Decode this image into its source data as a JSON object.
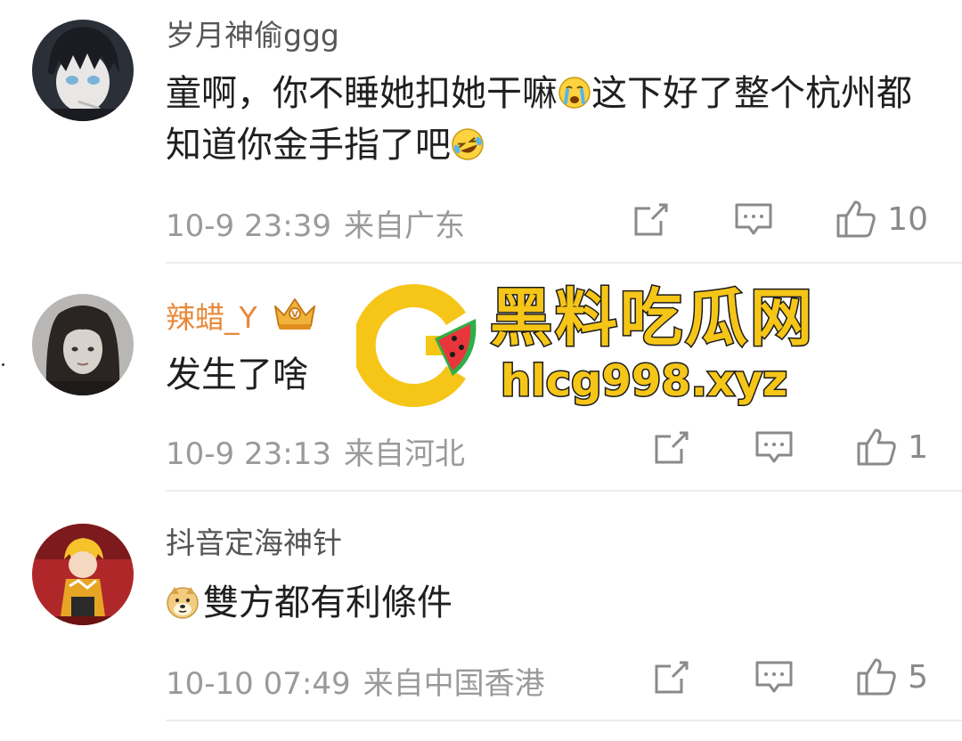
{
  "comments": [
    {
      "username": "岁月神偷ggg",
      "text_1": "童啊，你不睡她扣她干嘛",
      "emoji_1": "crying-emoji",
      "text_2": "这下好了整个杭州都知道你金手指了吧",
      "emoji_2": "laughing-tears-emoji",
      "timestamp": "10-9 23:39",
      "location": "来自广东",
      "likes": "10"
    },
    {
      "username": "辣蜡_Y",
      "badge": "crown-vip-icon",
      "text_1": "发生了啥",
      "timestamp": "10-9 23:13",
      "location": "来自河北",
      "likes": "1"
    },
    {
      "username": "抖音定海神针",
      "emoji_1": "doge-emoji",
      "text_1": "雙方都有利條件",
      "timestamp": "10-10 07:49",
      "location": "来自中国香港",
      "likes": "5"
    }
  ],
  "watermark": {
    "title": "黑料吃瓜网",
    "url": "hlcg998.xyz",
    "logo": "watermelon-c-logo"
  },
  "colors": {
    "username": "#555555",
    "vip_username": "#e8893a",
    "meta": "#9a9a9a",
    "watermark_yellow": "#f5c518"
  }
}
